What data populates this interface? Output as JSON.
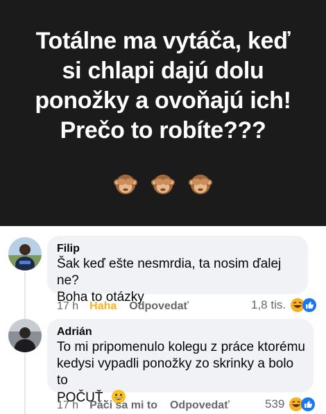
{
  "post": {
    "lines": [
      "Totálne ma vytáča, keď",
      "si chlapi dajú dolu",
      "ponožky a ovoňajú ich!",
      "Prečo to robíte???"
    ],
    "emojis": [
      "see-no-evil-monkey",
      "see-no-evil-monkey",
      "see-no-evil-monkey"
    ]
  },
  "comments": [
    {
      "author": "Filip",
      "lines": [
        "Šak keď ešte nesmrdia, ta nosim ďalej ne?",
        "Boha to otázky"
      ],
      "time": "17 h",
      "reaction_label": "Haha",
      "reply_label": "Odpovedať",
      "reaction_count": "1,8 tis.",
      "reaction_icons": [
        "haha",
        "like"
      ]
    },
    {
      "author": "Adrián",
      "lines": [
        "To mi pripomenulo kolegu z práce ktorému",
        "kedysi vypadli ponožky zo skrinky a bolo to",
        "POČUŤ."
      ],
      "trailing_emoji": "grinning-face",
      "time": "17 h",
      "reaction_label": "Páči sa mi to",
      "reply_label": "Odpovedať",
      "reaction_count": "539",
      "reaction_icons": [
        "haha",
        "like"
      ]
    }
  ],
  "colors": {
    "post_background": "#1b1b1b",
    "bubble": "#f0f2f5",
    "meta_text": "#65676b",
    "haha": "#f7b125",
    "like": "#1877f2"
  }
}
